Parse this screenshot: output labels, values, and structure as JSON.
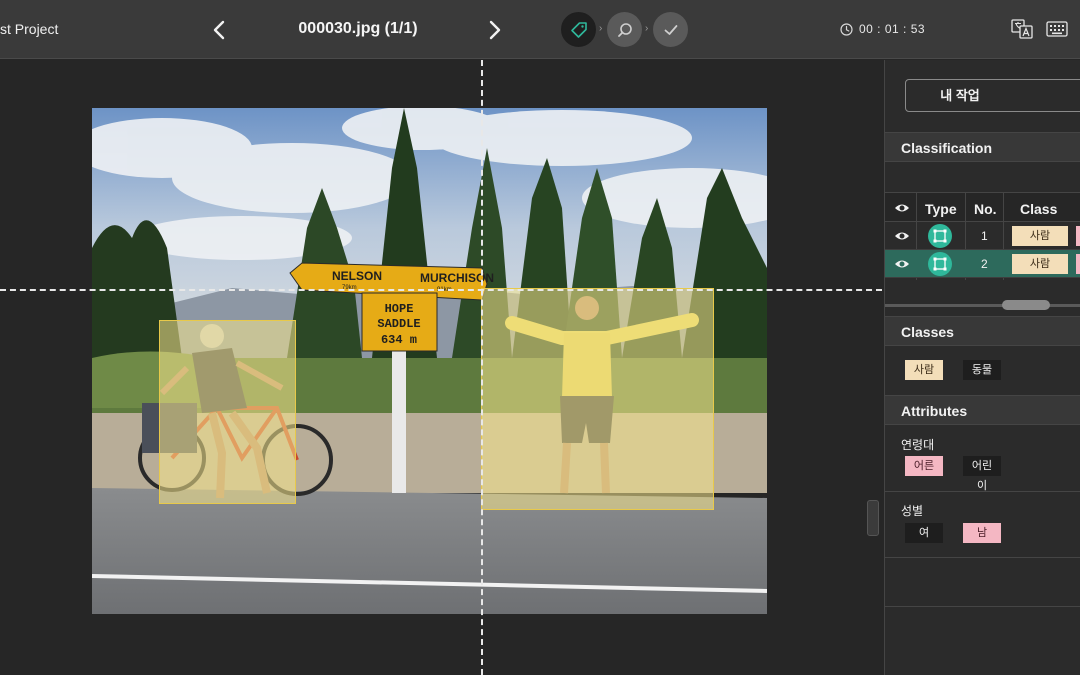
{
  "header": {
    "project_name": "st Project",
    "file_title": "000030.jpg (1/1)",
    "timer": "00 : 01 : 53",
    "icons": {
      "prev": "chevron-left-icon",
      "next": "chevron-right-icon",
      "step_label": "tag-icon",
      "step_review": "search-icon",
      "step_done": "check-icon",
      "clock": "clock-icon",
      "translate": "translate-icon",
      "keyboard": "keyboard-icon"
    },
    "accent": "#2fb89b"
  },
  "photo": {
    "sign_top_left": "NELSON",
    "sign_top_left_sub": "79km",
    "sign_top_right": "MURCHISON",
    "sign_top_right_sub": "91km",
    "sign_main": [
      "HOPE",
      "SADDLE",
      "634 m"
    ]
  },
  "panel": {
    "my_task_label": "내 작업",
    "classification": {
      "title": "Classification",
      "columns": [
        "Type",
        "No.",
        "Class"
      ],
      "rows": [
        {
          "no": "1",
          "class": "사람",
          "selected": false
        },
        {
          "no": "2",
          "class": "사람",
          "selected": true
        }
      ]
    },
    "classes": {
      "title": "Classes",
      "items": [
        "사람",
        "동물"
      ]
    },
    "attributes": {
      "title": "Attributes",
      "groups": [
        {
          "label": "연령대",
          "options": [
            "어른",
            "어린이"
          ]
        },
        {
          "label": "성별",
          "options": [
            "여",
            "남"
          ]
        }
      ]
    },
    "colors": {
      "peach": "#f3deb9",
      "pink": "#f4b7c3",
      "selected_row": "#2d6a5c"
    }
  }
}
